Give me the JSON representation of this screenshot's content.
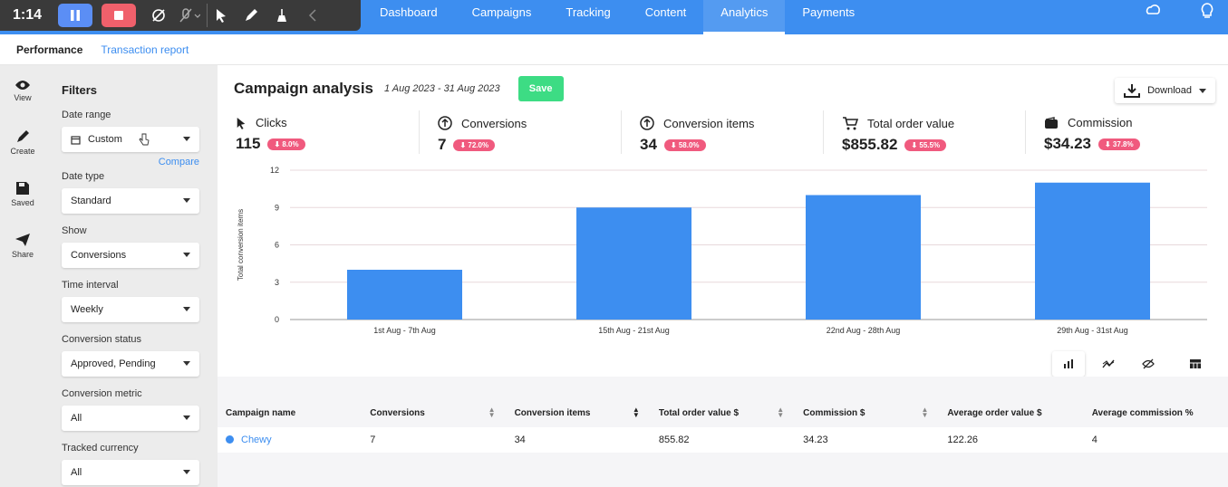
{
  "recorder": {
    "time": "1:14"
  },
  "nav": {
    "tabs": [
      "Dashboard",
      "Campaigns",
      "Tracking",
      "Content",
      "Analytics",
      "Payments"
    ],
    "active": "Analytics"
  },
  "subnav": {
    "performance": "Performance",
    "transaction_report": "Transaction report"
  },
  "rail": {
    "items": [
      "View",
      "Create",
      "Saved",
      "Share"
    ]
  },
  "filters": {
    "title": "Filters",
    "date_range_label": "Date range",
    "date_range_value": "Custom",
    "compare": "Compare",
    "date_type_label": "Date type",
    "date_type_value": "Standard",
    "show_label": "Show",
    "show_value": "Conversions",
    "time_interval_label": "Time interval",
    "time_interval_value": "Weekly",
    "conversion_status_label": "Conversion status",
    "conversion_status_value": "Approved, Pending",
    "conversion_metric_label": "Conversion metric",
    "conversion_metric_value": "All",
    "tracked_currency_label": "Tracked currency",
    "tracked_currency_value": "All"
  },
  "header": {
    "title": "Campaign analysis",
    "range": "1 Aug 2023 - 31 Aug 2023",
    "save": "Save",
    "download": "Download"
  },
  "kpis": [
    {
      "label": "Clicks",
      "value": "115",
      "badge": "⬇ 8.0%"
    },
    {
      "label": "Conversions",
      "value": "7",
      "badge": "⬇ 72.0%"
    },
    {
      "label": "Conversion items",
      "value": "34",
      "badge": "⬇ 58.0%"
    },
    {
      "label": "Total order value",
      "value": "$855.82",
      "badge": "⬇ 55.5%"
    },
    {
      "label": "Commission",
      "value": "$34.23",
      "badge": "⬇ 37.8%"
    }
  ],
  "colors": {
    "accent": "#3d8ef0",
    "bar": "#3d8ef0",
    "badge": "#f05a7e",
    "save": "#3ddc84"
  },
  "chart_data": {
    "type": "bar",
    "categories": [
      "1st Aug - 7th Aug",
      "15th Aug - 21st Aug",
      "22nd Aug - 28th Aug",
      "29th Aug - 31st Aug"
    ],
    "values": [
      4,
      9,
      10,
      11
    ],
    "ylabel": "Total conversion items",
    "yticks": [
      0,
      3,
      6,
      9,
      12
    ],
    "ylim": [
      0,
      12
    ],
    "grid": true
  },
  "table": {
    "headers": [
      "Campaign name",
      "Conversions",
      "Conversion items",
      "Total order value $",
      "Commission $",
      "Average order value $",
      "Average commission %"
    ],
    "rows": [
      [
        "Chewy",
        "7",
        "34",
        "855.82",
        "34.23",
        "122.26",
        "4"
      ]
    ]
  }
}
